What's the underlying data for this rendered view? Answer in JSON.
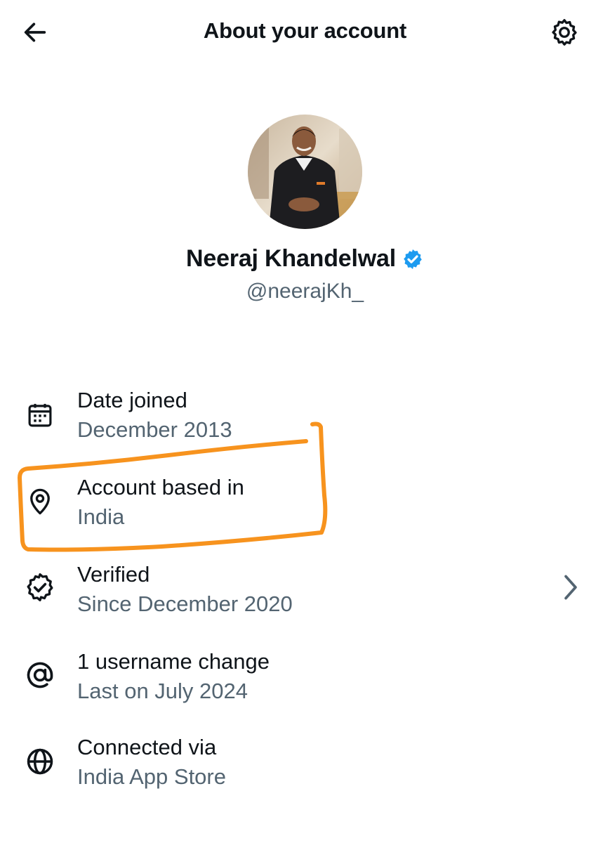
{
  "header": {
    "title": "About your account",
    "back_icon": "arrow-left-icon",
    "settings_icon": "gear-icon"
  },
  "profile": {
    "name": "Neeraj Khandelwal",
    "handle": "@neerajKh_",
    "verified_color": "#1d9bf0"
  },
  "rows": [
    {
      "icon": "calendar-icon",
      "label": "Date joined",
      "value": "December 2013"
    },
    {
      "icon": "location-pin-icon",
      "label": "Account based in",
      "value": "India"
    },
    {
      "icon": "verified-badge-icon",
      "label": "Verified",
      "value": "Since December 2020",
      "has_chevron": true
    },
    {
      "icon": "at-sign-icon",
      "label": "1 username change",
      "value": "Last on July 2024"
    },
    {
      "icon": "globe-icon",
      "label": "Connected via",
      "value": "India App Store"
    }
  ],
  "colors": {
    "text_primary": "#0f1419",
    "text_secondary": "#536471",
    "highlight_annotation": "#f7931e"
  }
}
